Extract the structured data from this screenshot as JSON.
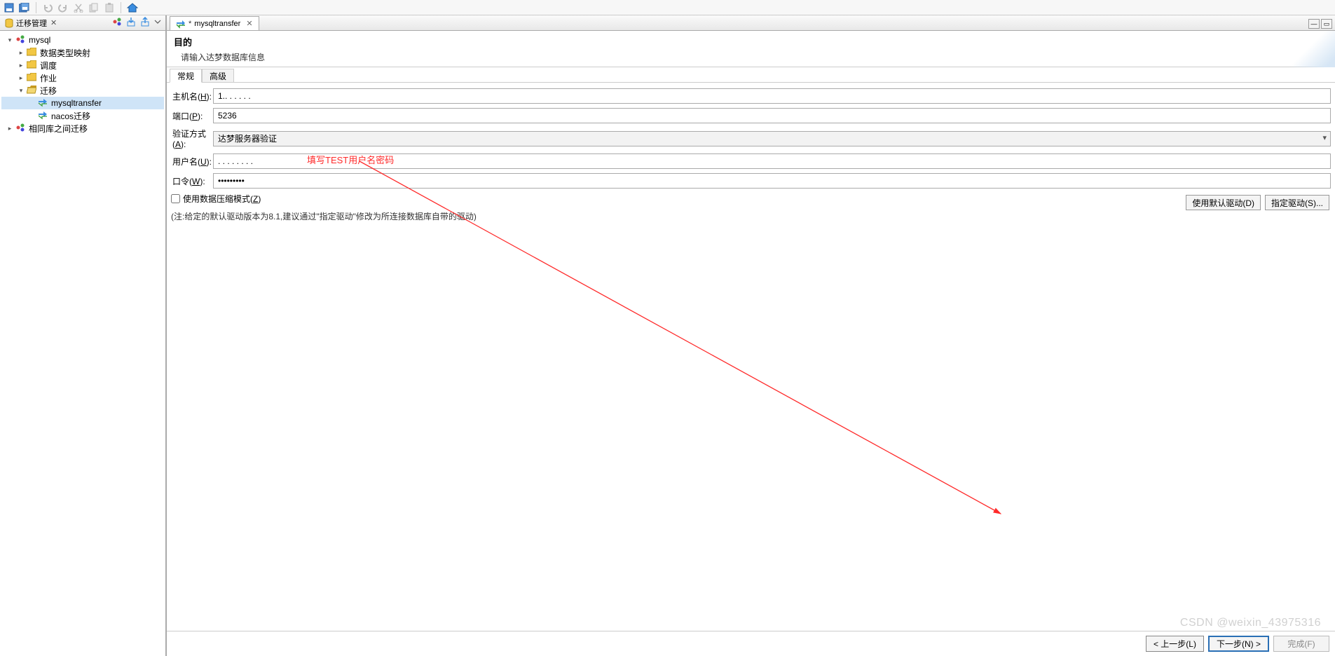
{
  "toolbar": {
    "icons": [
      "save-icon",
      "save-all-icon",
      "sep",
      "undo-icon",
      "redo-icon",
      "cut-icon",
      "copy-icon",
      "paste-icon",
      "sep",
      "home-icon"
    ]
  },
  "sidebar": {
    "tab": {
      "title": "迁移管理",
      "close_glyph": "✕"
    },
    "tools_icons": [
      "refresh-icon",
      "export-icon",
      "import-icon",
      "menu-icon"
    ],
    "tree": [
      {
        "level": 0,
        "expanded": true,
        "kind": "db",
        "label": "mysql"
      },
      {
        "level": 1,
        "expanded": false,
        "kind": "folder",
        "label": "数据类型映射"
      },
      {
        "level": 1,
        "expanded": false,
        "kind": "folder",
        "label": "调度"
      },
      {
        "level": 1,
        "expanded": false,
        "kind": "folder",
        "label": "作业"
      },
      {
        "level": 1,
        "expanded": true,
        "kind": "folder-open",
        "label": "迁移"
      },
      {
        "level": 2,
        "expanded": null,
        "kind": "transfer",
        "label": "mysqltransfer",
        "selected": true
      },
      {
        "level": 2,
        "expanded": null,
        "kind": "transfer",
        "label": "nacos迁移"
      },
      {
        "level": 0,
        "expanded": false,
        "kind": "db",
        "label": "相同库之间迁移"
      }
    ]
  },
  "editor": {
    "tab": {
      "dirty_prefix": "*",
      "title": "mysqltransfer",
      "close_glyph": "✕"
    }
  },
  "wizard": {
    "header": {
      "title": "目的",
      "subtitle": "请输入达梦数据库信息"
    },
    "tabs": {
      "active": "常规",
      "inactive": "高级"
    },
    "fields": {
      "host": {
        "label_pre": "主机名(",
        "label_u": "H",
        "label_post": "):",
        "value": "1.. . . . . ."
      },
      "port": {
        "label_pre": "端口(",
        "label_u": "P",
        "label_post": "):",
        "value": "5236"
      },
      "auth": {
        "label_pre": "验证方式(",
        "label_u": "A",
        "label_post": "):",
        "value": "达梦服务器验证"
      },
      "user": {
        "label_pre": "用户名(",
        "label_u": "U",
        "label_post": "):",
        "value": ". . . . . . . ."
      },
      "password": {
        "label_pre": "口令(",
        "label_u": "W",
        "label_post": "):",
        "value": "•••••••••"
      }
    },
    "compress": {
      "label_pre": "使用数据压缩模式(",
      "label_u": "Z",
      "label_post": ")",
      "checked": false
    },
    "driver_buttons": {
      "use_default": "使用默认驱动(D)",
      "specify": "指定驱动(S)..."
    },
    "note": "(注:给定的默认驱动版本为8.1,建议通过\"指定驱动\"修改为所连接数据库自带的驱动)",
    "footer": {
      "prev": "< 上一步(L)",
      "next": "下一步(N) >",
      "finish": "完成(F)"
    },
    "annotation_text": "填写TEST用户名密码"
  },
  "watermark": "CSDN @weixin_43975316"
}
